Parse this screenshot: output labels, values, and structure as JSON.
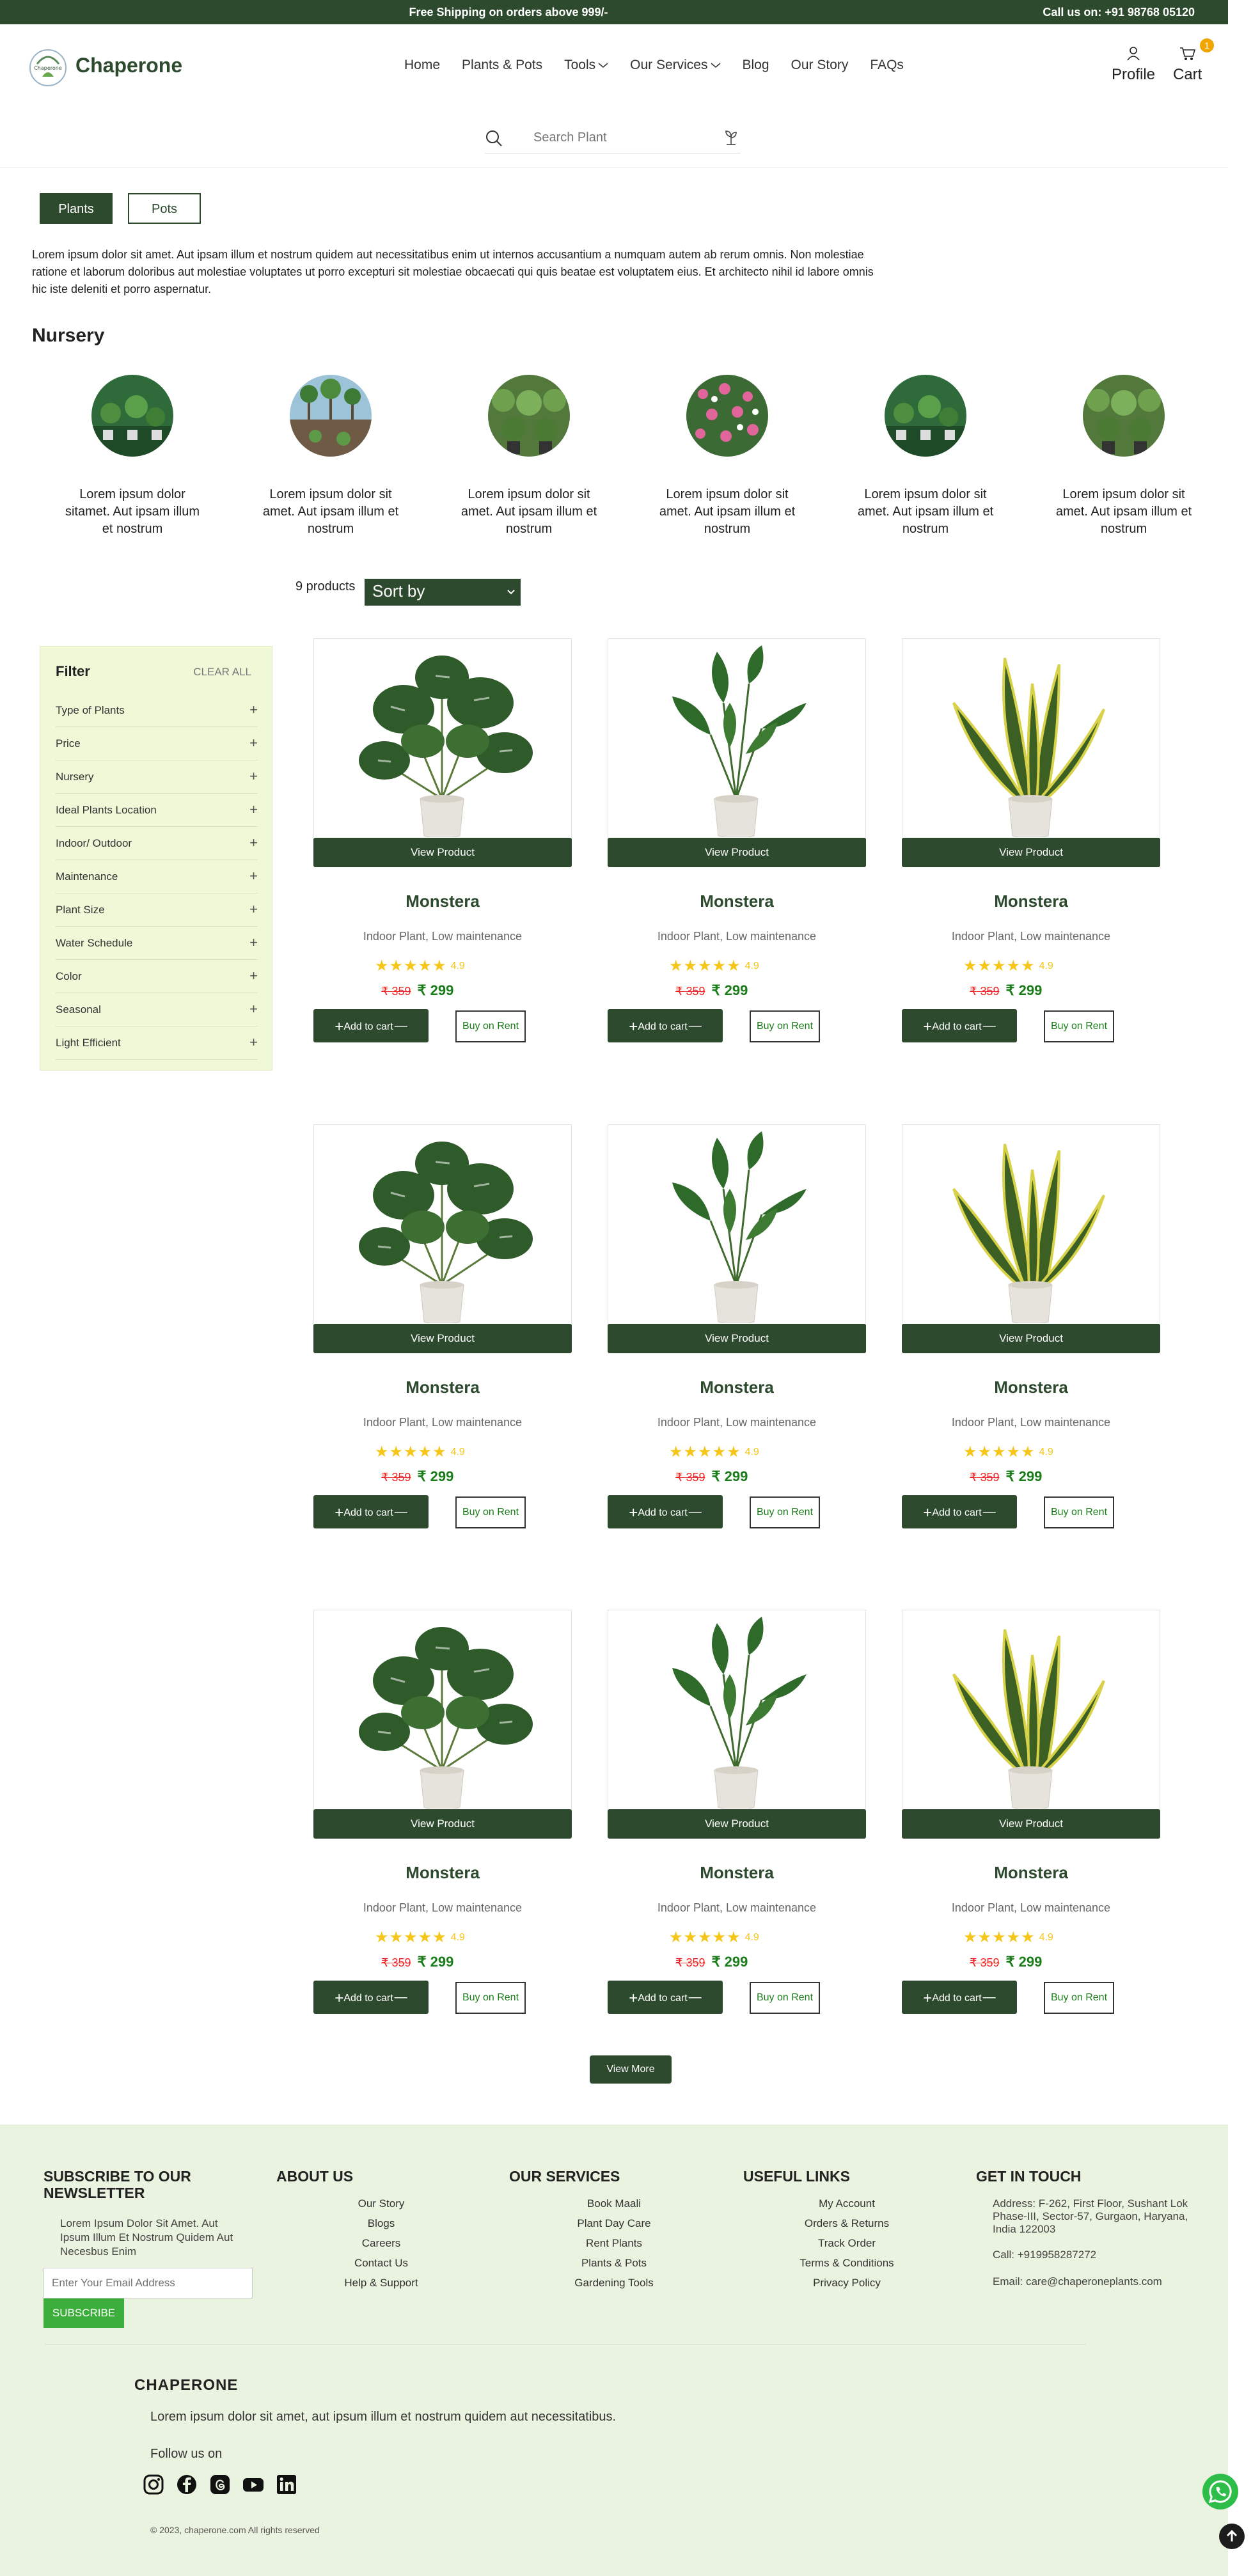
{
  "topbar": {
    "shipping": "Free Shipping on orders above 999/-",
    "call": "Call us on: +91 98768 05120"
  },
  "header": {
    "brand": "Chaperone",
    "nav": [
      {
        "label": "Home",
        "dropdown": false
      },
      {
        "label": "Plants & Pots",
        "dropdown": false
      },
      {
        "label": "Tools",
        "dropdown": true
      },
      {
        "label": "Our Services",
        "dropdown": true
      },
      {
        "label": "Blog",
        "dropdown": false
      },
      {
        "label": "Our Story",
        "dropdown": false
      },
      {
        "label": "FAQs",
        "dropdown": false
      }
    ],
    "profile": "Profile",
    "cart": "Cart",
    "cart_count": "1"
  },
  "search": {
    "placeholder": "Search Plant"
  },
  "tabs": {
    "plants": "Plants",
    "pots": "Pots"
  },
  "intro": "Lorem ipsum dolor sit amet. Aut ipsam illum et nostrum quidem aut necessitatibus enim ut internos accusantium a numquam autem ab rerum omnis. Non molestiae ratione et laborum doloribus aut molestiae voluptates ut porro excepturi sit molestiae obcaecati qui quis beatae est voluptatem eius. Et architecto nihil id labore omnis hic iste deleniti et porro aspernatur.",
  "nursery": {
    "title": "Nursery",
    "items": [
      {
        "text": "Lorem ipsum dolor sitamet. Aut ipsam illum et nostrum"
      },
      {
        "text": "Lorem ipsum dolor sit amet. Aut ipsam illum et nostrum"
      },
      {
        "text": "Lorem ipsum dolor sit amet. Aut ipsam illum et nostrum"
      },
      {
        "text": "Lorem ipsum dolor sit amet. Aut ipsam illum et nostrum"
      },
      {
        "text": "Lorem ipsum dolor sit amet. Aut ipsam illum et nostrum"
      },
      {
        "text": "Lorem ipsum dolor sit amet. Aut ipsam illum et nostrum"
      }
    ]
  },
  "listing": {
    "count": "9 products",
    "sort": "Sort by"
  },
  "filter": {
    "title": "Filter",
    "clear": "CLEAR ALL",
    "items": [
      "Type of Plants",
      "Price",
      "Nursery",
      "Ideal Plants Location",
      "Indoor/ Outdoor",
      "Maintenance",
      "Plant Size",
      "Water Schedule",
      "Color",
      "Seasonal",
      "Light Efficient"
    ]
  },
  "product_labels": {
    "view": "View Product",
    "add": "Add to cart",
    "rent": "Buy on Rent"
  },
  "products": [
    {
      "name": "Monstera",
      "sub": "Indoor Plant, Low maintenance",
      "rating": "4.9",
      "old_price": "₹ 359",
      "price": "₹ 299",
      "plant": "monstera"
    },
    {
      "name": "Monstera",
      "sub": "Indoor Plant, Low maintenance",
      "rating": "4.9",
      "old_price": "₹ 359",
      "price": "₹ 299",
      "plant": "bird"
    },
    {
      "name": "Monstera",
      "sub": "Indoor Plant, Low maintenance",
      "rating": "4.9",
      "old_price": "₹ 359",
      "price": "₹ 299",
      "plant": "snake"
    },
    {
      "name": "Monstera",
      "sub": "Indoor Plant, Low maintenance",
      "rating": "4.9",
      "old_price": "₹ 359",
      "price": "₹ 299",
      "plant": "monstera"
    },
    {
      "name": "Monstera",
      "sub": "Indoor Plant, Low maintenance",
      "rating": "4.9",
      "old_price": "₹ 359",
      "price": "₹ 299",
      "plant": "bird"
    },
    {
      "name": "Monstera",
      "sub": "Indoor Plant, Low maintenance",
      "rating": "4.9",
      "old_price": "₹ 359",
      "price": "₹ 299",
      "plant": "snake"
    },
    {
      "name": "Monstera",
      "sub": "Indoor Plant, Low maintenance",
      "rating": "4.9",
      "old_price": "₹ 359",
      "price": "₹ 299",
      "plant": "monstera"
    },
    {
      "name": "Monstera",
      "sub": "Indoor Plant, Low maintenance",
      "rating": "4.9",
      "old_price": "₹ 359",
      "price": "₹ 299",
      "plant": "bird"
    },
    {
      "name": "Monstera",
      "sub": "Indoor Plant, Low maintenance",
      "rating": "4.9",
      "old_price": "₹ 359",
      "price": "₹ 299",
      "plant": "snake"
    }
  ],
  "view_more": "View More",
  "footer": {
    "newsletter": {
      "title": "SUBSCRIBE TO OUR NEWSLETTER",
      "text": "Lorem Ipsum Dolor Sit Amet. Aut Ipsum Illum Et Nostrum Quidem Aut Necesbus Enim",
      "placeholder": "Enter Your Email Address",
      "button": "SUBSCRIBE"
    },
    "about": {
      "title": "ABOUT US",
      "links": [
        "Our Story",
        "Blogs",
        "Careers",
        "Contact Us",
        "Help & Support"
      ]
    },
    "services": {
      "title": "OUR SERVICES",
      "links": [
        "Book Maali",
        "Plant Day Care",
        "Rent Plants",
        "Plants & Pots",
        "Gardening Tools"
      ]
    },
    "useful": {
      "title": "USEFUL LINKS",
      "links": [
        "My Account",
        "Orders & Returns",
        "Track Order",
        "Terms & Conditions",
        "Privacy Policy"
      ]
    },
    "contact": {
      "title": "GET IN TOUCH",
      "address": "Address: F-262, First Floor, Sushant Lok Phase-III, Sector-57, Gurgaon, Haryana, India 122003",
      "call": "Call: +919958287272",
      "email": "Email: care@chaperoneplants.com"
    },
    "brand": "CHAPERONE",
    "brand_text": "Lorem ipsum dolor sit amet, aut ipsum illum et nostrum quidem aut necessitatibus.",
    "follow": "Follow us on",
    "socials": [
      "instagram-icon",
      "facebook-icon",
      "threads-icon",
      "youtube-icon",
      "linkedin-icon"
    ],
    "copyright": "© 2023, chaperone.com All rights reserved"
  },
  "colors": {
    "brand_green": "#2d4a2e",
    "filter_bg": "#eff9d8",
    "footer_bg": "#eaf3df",
    "price_green": "#1a7d1a",
    "old_price_red": "#e22222",
    "star": "#f5c518"
  }
}
